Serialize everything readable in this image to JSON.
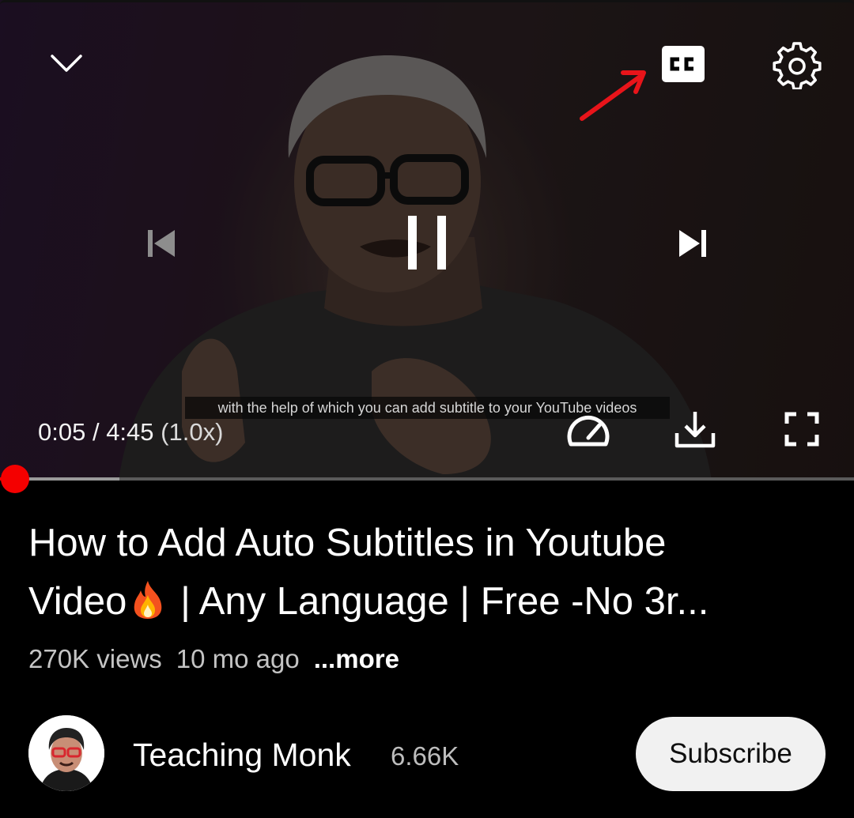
{
  "player": {
    "caption_text": "with the help of which you can add subtitle to your YouTube videos",
    "current_time": "0:05",
    "separator": " / ",
    "duration": "4:45",
    "playback_rate": "(1.0x)",
    "progress_fraction": 0.0175,
    "buffered_fraction": 0.14,
    "icons": {
      "collapse": "chevron-down-icon",
      "captions": "closed-captions-icon",
      "settings": "gear-icon",
      "previous": "skip-previous-icon",
      "pause": "pause-icon",
      "next": "skip-next-icon",
      "speed": "speedometer-icon",
      "download": "download-icon",
      "fullscreen": "fullscreen-icon"
    },
    "annotation_color": "#e8141a"
  },
  "video": {
    "title_line1": "How to Add Auto Subtitles in Youtube",
    "title_line2_start": "Video",
    "title_line2_end": " | Any Language | Free -No 3r...",
    "views": "270K views",
    "age": "10 mo ago",
    "more_label": "...more"
  },
  "channel": {
    "name": "Teaching Monk",
    "subscriber_count": "6.66K",
    "subscribe_label": "Subscribe"
  },
  "colors": {
    "progress_played": "#ff0000",
    "background": "#000000",
    "subscribe_bg": "#f1f1f1"
  }
}
